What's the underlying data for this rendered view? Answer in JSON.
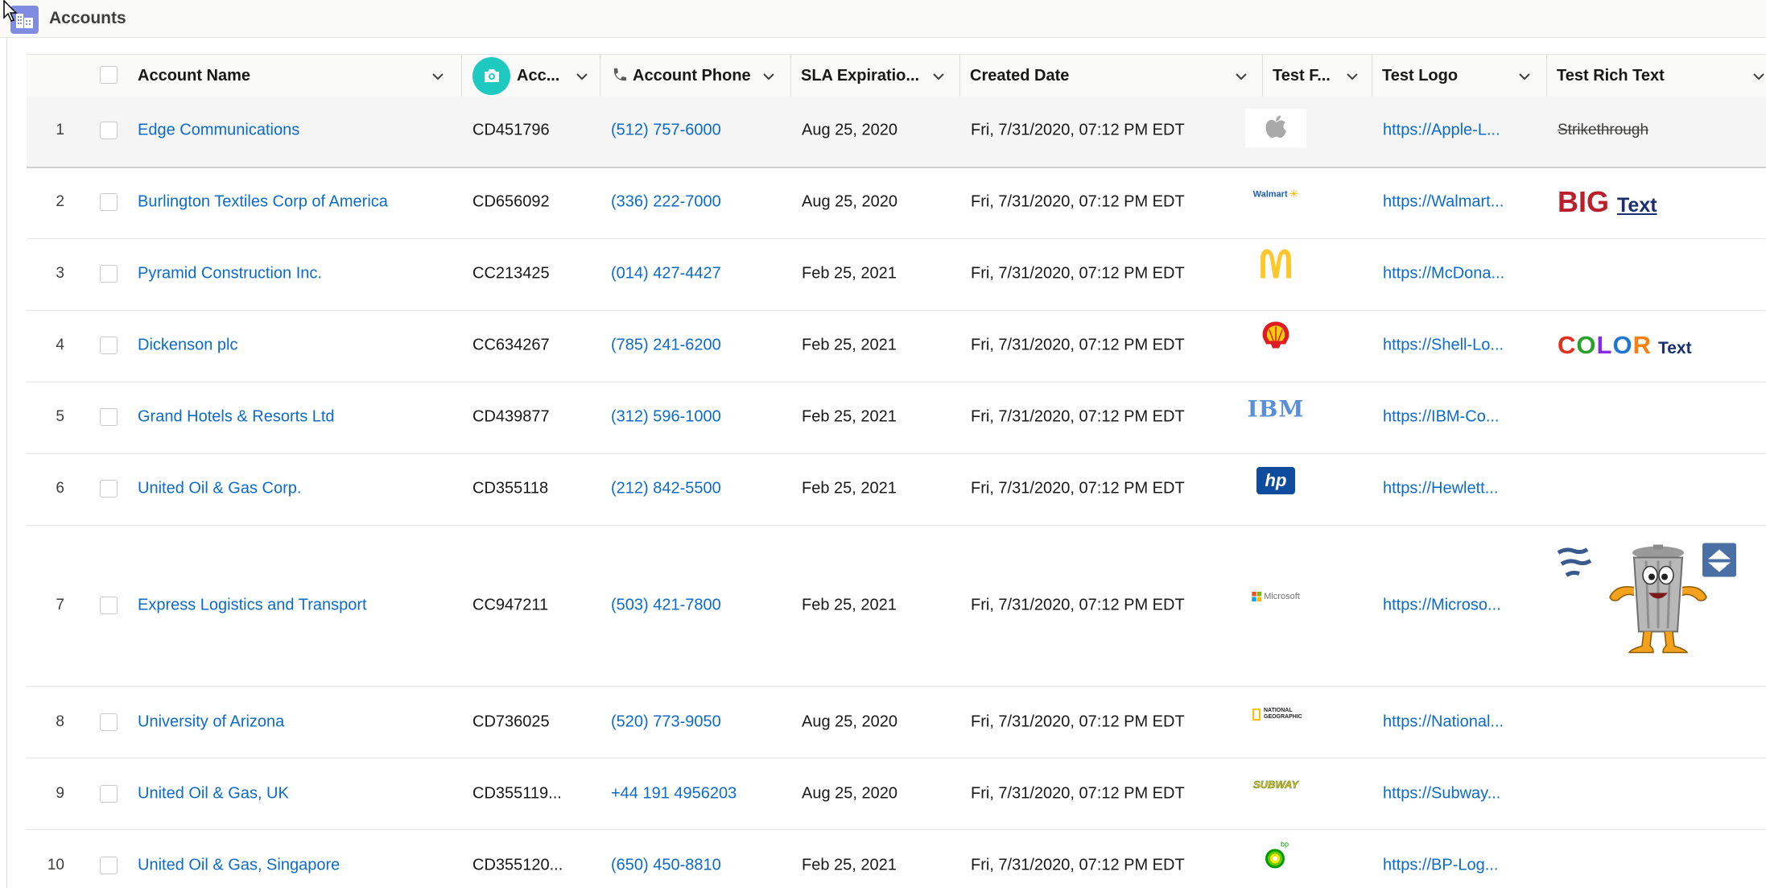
{
  "app": {
    "title": "Accounts",
    "icon": "accounts-grid-icon"
  },
  "columns": [
    {
      "key": "account_name",
      "label": "Account Name"
    },
    {
      "key": "account_number",
      "label": "Acc...",
      "icon": "camera-icon"
    },
    {
      "key": "account_phone",
      "label": "Account Phone",
      "icon": "phone-icon"
    },
    {
      "key": "sla_expiration",
      "label": "SLA Expiratio..."
    },
    {
      "key": "created_date",
      "label": "Created Date"
    },
    {
      "key": "test_formula",
      "label": "Test F..."
    },
    {
      "key": "test_logo",
      "label": "Test Logo"
    },
    {
      "key": "test_rich_text",
      "label": "Test Rich Text"
    }
  ],
  "rows": [
    {
      "num": "1",
      "name": "Edge Communications",
      "number": "CD451796",
      "phone": "(512) 757-6000",
      "sla": "Aug 25, 2020",
      "created": "Fri, 7/31/2020, 07:12 PM EDT",
      "logo": "apple-logo",
      "url": "https://Apple-L...",
      "rich": "Strikethrough"
    },
    {
      "num": "2",
      "name": "Burlington Textiles Corp of America",
      "number": "CD656092",
      "phone": "(336) 222-7000",
      "sla": "Aug 25, 2020",
      "created": "Fri, 7/31/2020, 07:12 PM EDT",
      "logo": "walmart-logo",
      "logo_text": "Walmart",
      "url": "https://Walmart...",
      "rich_big": "BIG",
      "rich_text": "Text"
    },
    {
      "num": "3",
      "name": "Pyramid Construction Inc.",
      "number": "CC213425",
      "phone": "(014) 427-4427",
      "sla": "Feb 25, 2021",
      "created": "Fri, 7/31/2020, 07:12 PM EDT",
      "logo": "mcdonalds-logo",
      "url": "https://McDona..."
    },
    {
      "num": "4",
      "name": "Dickenson plc",
      "number": "CC634267",
      "phone": "(785) 241-6200",
      "sla": "Feb 25, 2021",
      "created": "Fri, 7/31/2020, 07:12 PM EDT",
      "logo": "shell-logo",
      "url": "https://Shell-Lo...",
      "rich_color_letters": [
        "C",
        "O",
        "L",
        "O",
        "R"
      ],
      "rich_color_colors": [
        "#e0301e",
        "#2ca02c",
        "#8a2be2",
        "#1f77d4",
        "#ff7f0e"
      ],
      "rich_text": "Text"
    },
    {
      "num": "5",
      "name": "Grand Hotels & Resorts Ltd",
      "number": "CD439877",
      "phone": "(312) 596-1000",
      "sla": "Feb 25, 2021",
      "created": "Fri, 7/31/2020, 07:12 PM EDT",
      "logo": "ibm-logo",
      "logo_text": "IBM",
      "url": "https://IBM-Co..."
    },
    {
      "num": "6",
      "name": "United Oil & Gas Corp.",
      "number": "CD355118",
      "phone": "(212) 842-5500",
      "sla": "Feb 25, 2021",
      "created": "Fri, 7/31/2020, 07:12 PM EDT",
      "logo": "hp-logo",
      "logo_text": "hp",
      "url": "https://Hewlett..."
    },
    {
      "num": "7",
      "name": "Express Logistics and Transport",
      "number": "CC947211",
      "phone": "(503) 421-7800",
      "sla": "Feb 25, 2021",
      "created": "Fri, 7/31/2020, 07:12 PM EDT",
      "logo": "microsoft-logo",
      "logo_text": "Microsoft",
      "url": "https://Microso...",
      "rich_image": "trash-can-cartoon"
    },
    {
      "num": "8",
      "name": "University of Arizona",
      "number": "CD736025",
      "phone": "(520) 773-9050",
      "sla": "Aug 25, 2020",
      "created": "Fri, 7/31/2020, 07:12 PM EDT",
      "logo": "national-geographic-logo",
      "logo_text": "NATIONAL GEOGRAPHIC",
      "url": "https://National..."
    },
    {
      "num": "9",
      "name": "United Oil & Gas, UK",
      "number": "CD355119...",
      "phone": "+44 191 4956203",
      "sla": "Aug 25, 2020",
      "created": "Fri, 7/31/2020, 07:12 PM EDT",
      "logo": "subway-logo",
      "logo_text": "SUBWAY",
      "url": "https://Subway..."
    },
    {
      "num": "10",
      "name": "United Oil & Gas, Singapore",
      "number": "CD355120...",
      "phone": "(650) 450-8810",
      "sla": "Feb 25, 2021",
      "created": "Fri, 7/31/2020, 07:12 PM EDT",
      "logo": "bp-logo",
      "logo_text": "bp",
      "url": "https://BP-Log..."
    }
  ],
  "colors": {
    "link": "#0b6bcb",
    "accent_camera": "#1ec9c0",
    "app_icon": "#7f8de1"
  }
}
